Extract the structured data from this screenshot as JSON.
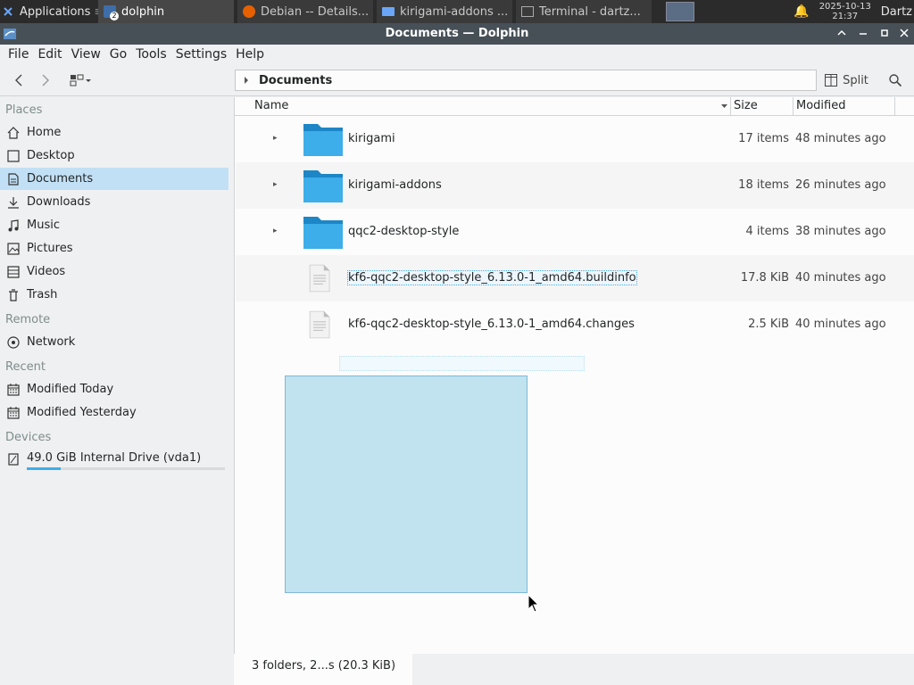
{
  "taskbar": {
    "applications_label": "Applications",
    "tasks": [
      {
        "label": "dolphin",
        "badge": "2"
      },
      {
        "label": "Debian -- Details..."
      },
      {
        "label": "kirigami-addons ..."
      },
      {
        "label": "Terminal - dartz..."
      }
    ],
    "clock_date": "2025-10-13",
    "clock_time": "21:37",
    "user": "Dartz"
  },
  "window": {
    "title": "Documents — Dolphin"
  },
  "menubar": [
    "File",
    "Edit",
    "View",
    "Go",
    "Tools",
    "Settings",
    "Help"
  ],
  "toolbar": {
    "breadcrumb": "Documents",
    "split_label": "Split"
  },
  "sidebar": {
    "sections": {
      "places": "Places",
      "remote": "Remote",
      "recent": "Recent",
      "devices": "Devices"
    },
    "places": [
      {
        "label": "Home",
        "icon": "home-icon"
      },
      {
        "label": "Desktop",
        "icon": "desktop-icon"
      },
      {
        "label": "Documents",
        "icon": "documents-icon",
        "selected": true
      },
      {
        "label": "Downloads",
        "icon": "downloads-icon"
      },
      {
        "label": "Music",
        "icon": "music-icon"
      },
      {
        "label": "Pictures",
        "icon": "pictures-icon"
      },
      {
        "label": "Videos",
        "icon": "videos-icon"
      },
      {
        "label": "Trash",
        "icon": "trash-icon"
      }
    ],
    "remote": [
      {
        "label": "Network",
        "icon": "network-icon"
      }
    ],
    "recent": [
      {
        "label": "Modified Today",
        "icon": "calendar-icon"
      },
      {
        "label": "Modified Yesterday",
        "icon": "calendar-icon"
      }
    ],
    "devices": [
      {
        "label": "49.0 GiB Internal Drive (vda1)",
        "icon": "drive-icon",
        "usage_fraction": 0.17
      }
    ]
  },
  "columns": {
    "name": "Name",
    "size": "Size",
    "modified": "Modified"
  },
  "files": [
    {
      "name": "kirigami",
      "type": "folder",
      "size": "17 items",
      "modified": "48 minutes ago"
    },
    {
      "name": "kirigami-addons",
      "type": "folder",
      "size": "18 items",
      "modified": "26 minutes ago"
    },
    {
      "name": "qqc2-desktop-style",
      "type": "folder",
      "size": "4 items",
      "modified": "38 minutes ago"
    },
    {
      "name": "kf6-qqc2-desktop-style_6.13.0-1_amd64.buildinfo",
      "type": "file",
      "size": "17.8 KiB",
      "modified": "40 minutes ago"
    },
    {
      "name": "kf6-qqc2-desktop-style_6.13.0-1_amd64.changes",
      "type": "file",
      "size": "2.5 KiB",
      "modified": "40 minutes ago"
    }
  ],
  "status": {
    "text": "3 folders, 2...s (20.3 KiB)"
  },
  "colors": {
    "accent": "#3daee9",
    "selection": "#c2e0f5",
    "folder": "#3daee9",
    "titlebar": "#475057"
  }
}
